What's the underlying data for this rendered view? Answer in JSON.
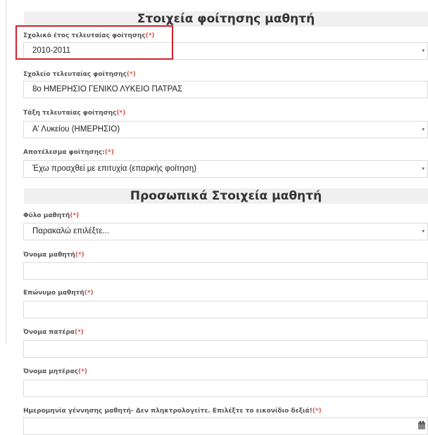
{
  "sections": {
    "attendance_title": "Στοιχεία φοίτησης μαθητή",
    "personal_title": "Προσωπικά Στοιχεία μαθητή"
  },
  "required_mark": "(*)",
  "fields": {
    "school_year": {
      "label": "Σχολικό έτος τελευταίας φοίτησης",
      "value": "2010-2011"
    },
    "school": {
      "label": "Σχολείο τελευταίας φοίτησης",
      "value": "8ο ΗΜΕΡΗΣΙΟ ΓΕΝΙΚΟ ΛΥΚΕΙΟ ΠΑΤΡΑΣ"
    },
    "class": {
      "label": "Τάξη τελευταίας φοίτησης",
      "value": "Α' Λυκείου (ΗΜΕΡΗΣΙΟ)"
    },
    "result": {
      "label": "Αποτέλεσμα φοίτησης:",
      "value": "Έχω προαχθεί με επιτυχία (επαρκής φοίτηση)"
    },
    "gender": {
      "label": "Φύλο μαθητή",
      "value": "Παρακαλώ επιλέξτε..."
    },
    "first_name": {
      "label": "Όνομα μαθητή",
      "value": ""
    },
    "last_name": {
      "label": "Επώνυμο μαθητή",
      "value": ""
    },
    "father_name": {
      "label": "Όνομα πατέρα",
      "value": ""
    },
    "mother_name": {
      "label": "Όνομα μητέρας",
      "value": ""
    },
    "birth_date": {
      "label": "Ημερομηνία γέννησης μαθητή- Δεν πληκτρολογείτε. Επιλέξτε το εικονίδιο δεξιά!",
      "value": ""
    }
  },
  "icons": {
    "select_caret": "▾",
    "calendar": "calendar-icon"
  },
  "colors": {
    "required": "#d9534f",
    "highlight": "#d6202a",
    "header_bg": "#f0f0f0"
  }
}
